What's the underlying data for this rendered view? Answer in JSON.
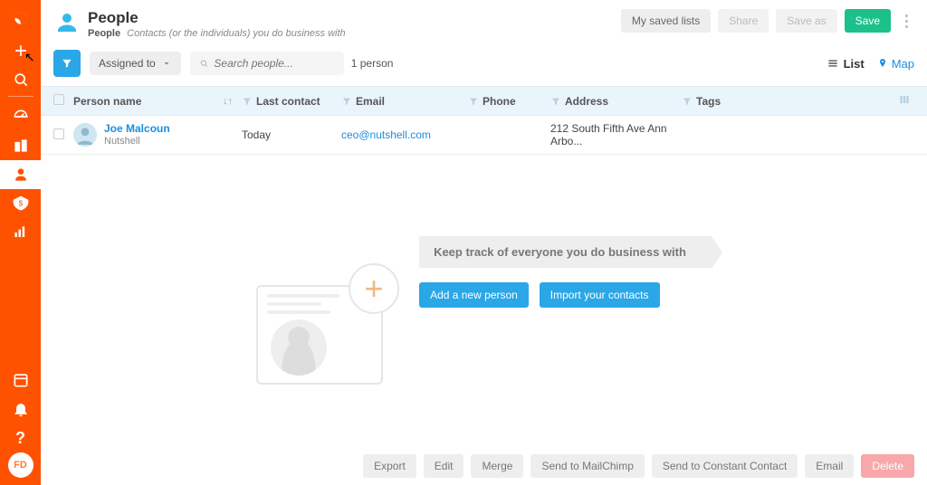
{
  "sidebar": {
    "avatar": "FD"
  },
  "header": {
    "title": "People",
    "sub_label": "People",
    "sub_desc": "Contacts (or the individuals) you do business with",
    "btn_saved": "My saved lists",
    "btn_share": "Share",
    "btn_saveas": "Save as",
    "btn_save": "Save"
  },
  "toolbar": {
    "assigned_label": "Assigned to",
    "search_placeholder": "Search people...",
    "count": "1 person",
    "list_label": "List",
    "map_label": "Map"
  },
  "columns": {
    "name": "Person name",
    "last": "Last contact",
    "email": "Email",
    "phone": "Phone",
    "address": "Address",
    "tags": "Tags"
  },
  "rows": [
    {
      "name": "Joe Malcoun",
      "company": "Nutshell",
      "last": "Today",
      "email": "ceo@nutshell.com",
      "phone": "",
      "address": "212 South Fifth Ave Ann Arbo...",
      "tags": ""
    }
  ],
  "promo": {
    "headline": "Keep track of everyone you do business with",
    "btn_add": "Add a new person",
    "btn_import": "Import your contacts"
  },
  "footer": {
    "export": "Export",
    "edit": "Edit",
    "merge": "Merge",
    "mailchimp": "Send to MailChimp",
    "constant": "Send to Constant Contact",
    "email": "Email",
    "delete": "Delete"
  }
}
